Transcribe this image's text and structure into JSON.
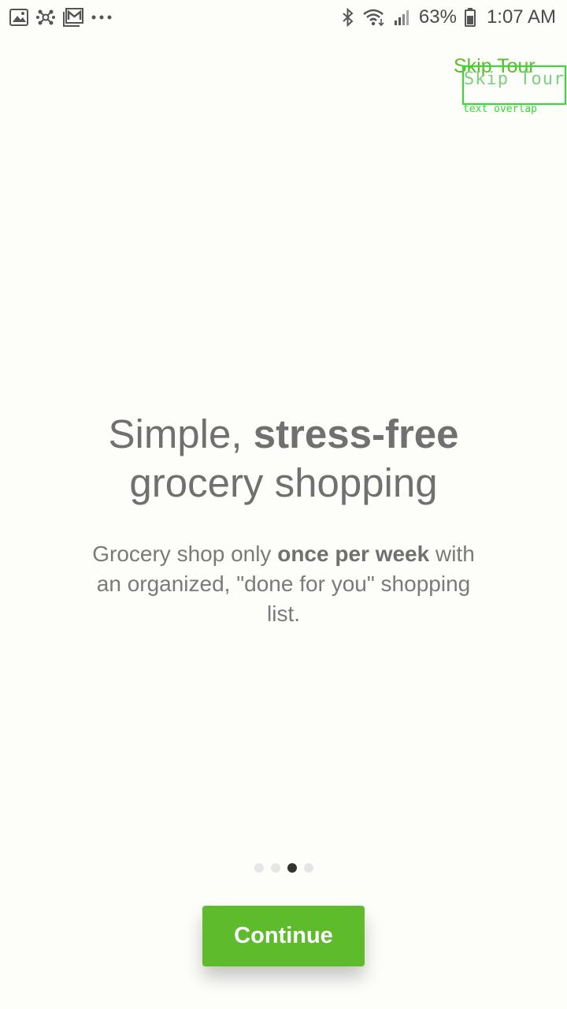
{
  "status_bar": {
    "left_icons": [
      "image-icon",
      "network-hub-icon",
      "gmail-icon",
      "more-dots-icon"
    ],
    "right_icons": [
      "bluetooth-icon",
      "wifi-icon",
      "signal-icon",
      "battery-icon"
    ],
    "battery_percent": "63%",
    "time": "1:07 AM"
  },
  "header": {
    "skip_label": "Skip Tour",
    "overlap_ghost_text": "Skip Tour?",
    "overlap_caption": "text overlap"
  },
  "hero": {
    "line1_regular": "Simple, ",
    "line1_bold": "stress-free",
    "line2": "grocery shopping"
  },
  "description": {
    "part1": "Grocery shop only ",
    "bold": "once per week",
    "part2": " with an organized, \"done for you\" shopping list."
  },
  "pager": {
    "total_pages": 4,
    "active_index": 2
  },
  "actions": {
    "continue_label": "Continue"
  },
  "colors": {
    "accent": "#5dbb2c",
    "background": "#fdfdfa",
    "text": "#707070",
    "overlay": "#2ee02e"
  }
}
